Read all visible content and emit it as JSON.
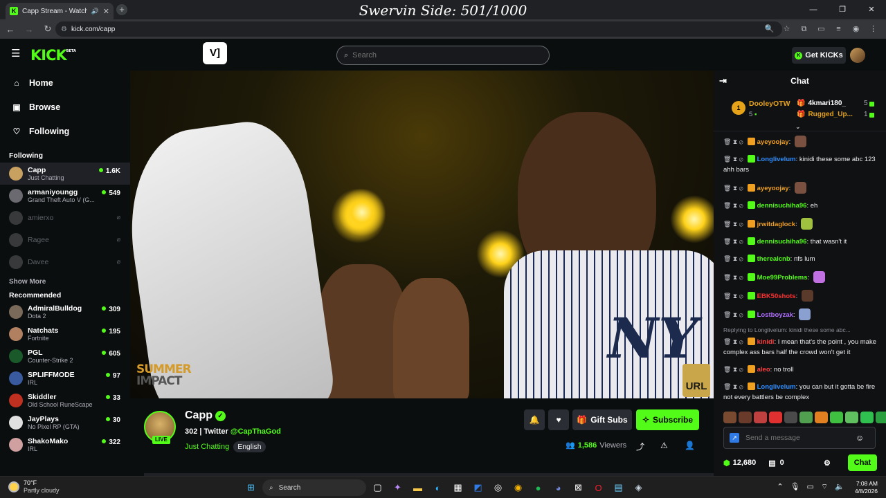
{
  "browser": {
    "tab_title": "Capp Stream - Watch Live ...",
    "tab_favicon": "K",
    "new_tab": "+",
    "url": "kick.com/capp",
    "overlay_title": "Swervin Side: 501/1000",
    "window_controls": [
      "—",
      "❐",
      "✕"
    ]
  },
  "header": {
    "logo": "KICK",
    "logo_beta": "BETA",
    "search_placeholder": "Search",
    "get_kicks": "Get KICKs"
  },
  "sidebar": {
    "nav": [
      {
        "label": "Home",
        "icon": "home-icon"
      },
      {
        "label": "Browse",
        "icon": "browse-icon"
      },
      {
        "label": "Following",
        "icon": "heart-icon"
      }
    ],
    "following_title": "Following",
    "following": [
      {
        "name": "Capp",
        "game": "Just Chatting",
        "viewers": "1.6K",
        "color": "#c8a060"
      },
      {
        "name": "armaniyoungg",
        "game": "Grand Theft Auto V (G...",
        "viewers": "549",
        "color": "#6a6a70"
      },
      {
        "name": "amierxo",
        "game": "",
        "viewers": "",
        "color": "#8a8a90"
      },
      {
        "name": "Ragee",
        "game": "",
        "viewers": "",
        "color": "#8a8a90"
      },
      {
        "name": "Davee",
        "game": "",
        "viewers": "",
        "color": "#8a8a90"
      }
    ],
    "show_more": "Show More",
    "recommended_title": "Recommended",
    "recommended": [
      {
        "name": "AdmiralBulldog",
        "game": "Dota 2",
        "viewers": "309",
        "color": "#7a6a5a"
      },
      {
        "name": "Natchats",
        "game": "Fortnite",
        "viewers": "195",
        "color": "#b08060"
      },
      {
        "name": "PGL",
        "game": "Counter-Strike 2",
        "viewers": "605",
        "color": "#1a5a2a"
      },
      {
        "name": "SPLIFFMODE",
        "game": "IRL",
        "viewers": "97",
        "color": "#3a5aa0"
      },
      {
        "name": "Skiddler",
        "game": "Old School RuneScape",
        "viewers": "33",
        "color": "#c03020"
      },
      {
        "name": "JayPlays",
        "game": "No Pixel RP (GTA)",
        "viewers": "30",
        "color": "#e0e0e0"
      },
      {
        "name": "ShakoMako",
        "game": "IRL",
        "viewers": "322",
        "color": "#d0a0a0"
      }
    ]
  },
  "video": {
    "overlay_left": [
      "SUMMER",
      "IMPACT"
    ],
    "overlay_right": "URL"
  },
  "channel": {
    "name": "Capp",
    "live": "LIVE",
    "title_prefix": "302 | Twitter ",
    "twitter": "@CapThaGod",
    "category": "Just Chatting",
    "language": "English",
    "gift_subs": "Gift Subs",
    "subscribe": "Subscribe",
    "viewers_count": "1,586",
    "viewers_label": "Viewers"
  },
  "chat": {
    "title": "Chat",
    "leaderboard": {
      "first": {
        "rank": "1",
        "name": "DooleyOTW",
        "count": "5"
      },
      "others": [
        {
          "name": "4kmari180_",
          "count": "5"
        },
        {
          "name": "Rugged_Up...",
          "count": "1"
        }
      ]
    },
    "messages": [
      {
        "user": "ayeyoojay",
        "text": "",
        "color": "#f0a020",
        "emote": "#7a5040"
      },
      {
        "user": "Longlivelum",
        "text": "kinidi these some abc 123 ahh bars",
        "color": "#2f8fff",
        "emote": ""
      },
      {
        "user": "ayeyoojay",
        "text": "",
        "color": "#f0a020",
        "emote": "#7a5040"
      },
      {
        "user": "dennisuchiha96",
        "text": "eh",
        "color": "#53fc18",
        "emote": ""
      },
      {
        "user": "jrwitdaglock",
        "text": "",
        "color": "#f0a020",
        "emote": "#a0c040"
      },
      {
        "user": "dennisuchiha96",
        "text": "that wasn't it",
        "color": "#53fc18",
        "emote": ""
      },
      {
        "user": "therealcnb",
        "text": "nfs lum",
        "color": "#53fc18",
        "emote": ""
      },
      {
        "user": "Moe99Problems",
        "text": "",
        "color": "#53fc18",
        "emote": "#c070e0"
      },
      {
        "user": "EBK50shots",
        "text": "",
        "color": "#ff3030",
        "emote": "#5a3a2a"
      },
      {
        "user": "Lostboyzak",
        "text": "",
        "color": "#b070ff",
        "emote": "#8aa0d0"
      }
    ],
    "reply_context": "Replying to Longlivelum: kinidi these some abc...",
    "messages2": [
      {
        "user": "kinidi",
        "text": "I mean that's the point , you make complex ass bars half the crowd won't get it",
        "color": "#ff4040"
      },
      {
        "user": "aleo",
        "text": "no troll",
        "color": "#ff4040"
      },
      {
        "user": "Longlivelum",
        "text": "you can but it gotta be fire not every battlers be complex",
        "color": "#2f8fff"
      }
    ],
    "send_placeholder": "Send a message",
    "kicks_balance": "12,680",
    "items_count": "0",
    "chat_button": "Chat"
  },
  "taskbar": {
    "temp": "70°F",
    "weather": "Partly cloudy",
    "search": "Search",
    "time": "7:08 AM",
    "date": "4/8/2026"
  }
}
